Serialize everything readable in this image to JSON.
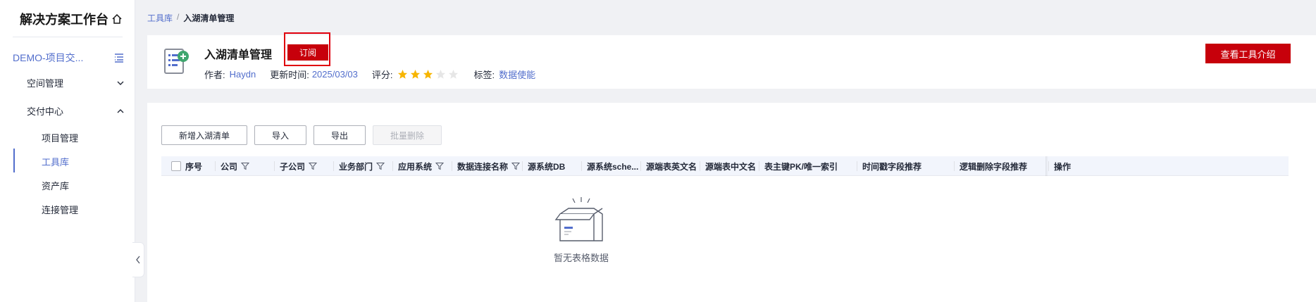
{
  "sidebar": {
    "title": "解决方案工作台",
    "project_label": "DEMO-项目交...",
    "groups": [
      {
        "label": "空间管理",
        "expanded": false
      },
      {
        "label": "交付中心",
        "expanded": true
      }
    ],
    "items": [
      {
        "label": "项目管理"
      },
      {
        "label": "工具库",
        "active": true
      },
      {
        "label": "资产库"
      },
      {
        "label": "连接管理"
      }
    ]
  },
  "breadcrumb": {
    "parent": "工具库",
    "separator": "/",
    "current": "入湖清单管理"
  },
  "tool": {
    "name": "入湖清单管理",
    "subscribe_label": "订阅",
    "author_label": "作者:",
    "author": "Haydn",
    "updated_label": "更新时间:",
    "updated": "2025/03/03",
    "rating_label": "评分:",
    "rating": 3,
    "rating_max": 5,
    "tag_label": "标签:",
    "tag": "数据使能",
    "intro_button": "查看工具介绍"
  },
  "toolbar": {
    "add_label": "新增入湖清单",
    "import_label": "导入",
    "export_label": "导出",
    "batch_delete_label": "批量删除"
  },
  "table": {
    "columns": [
      {
        "label": "序号",
        "filter": false
      },
      {
        "label": "公司",
        "filter": true
      },
      {
        "label": "子公司",
        "filter": true
      },
      {
        "label": "业务部门",
        "filter": true
      },
      {
        "label": "应用系统",
        "filter": true
      },
      {
        "label": "数据连接名称",
        "filter": true
      },
      {
        "label": "源系统DB",
        "filter": false
      },
      {
        "label": "源系统sche...",
        "filter": false
      },
      {
        "label": "源端表英文名",
        "filter": false
      },
      {
        "label": "源端表中文名",
        "filter": false
      },
      {
        "label": "表主键PK/唯一索引",
        "filter": false
      },
      {
        "label": "时间戳字段推荐",
        "filter": false
      },
      {
        "label": "逻辑删除字段推荐",
        "filter": false
      },
      {
        "label": "操作",
        "filter": false
      }
    ],
    "rows": [],
    "empty_text": "暂无表格数据"
  },
  "colors": {
    "accent": "#526ecc",
    "brand_red": "#c7000b",
    "highlight": "#e0000d",
    "star": "#f7b500",
    "star_empty": "#e6e6e6"
  }
}
